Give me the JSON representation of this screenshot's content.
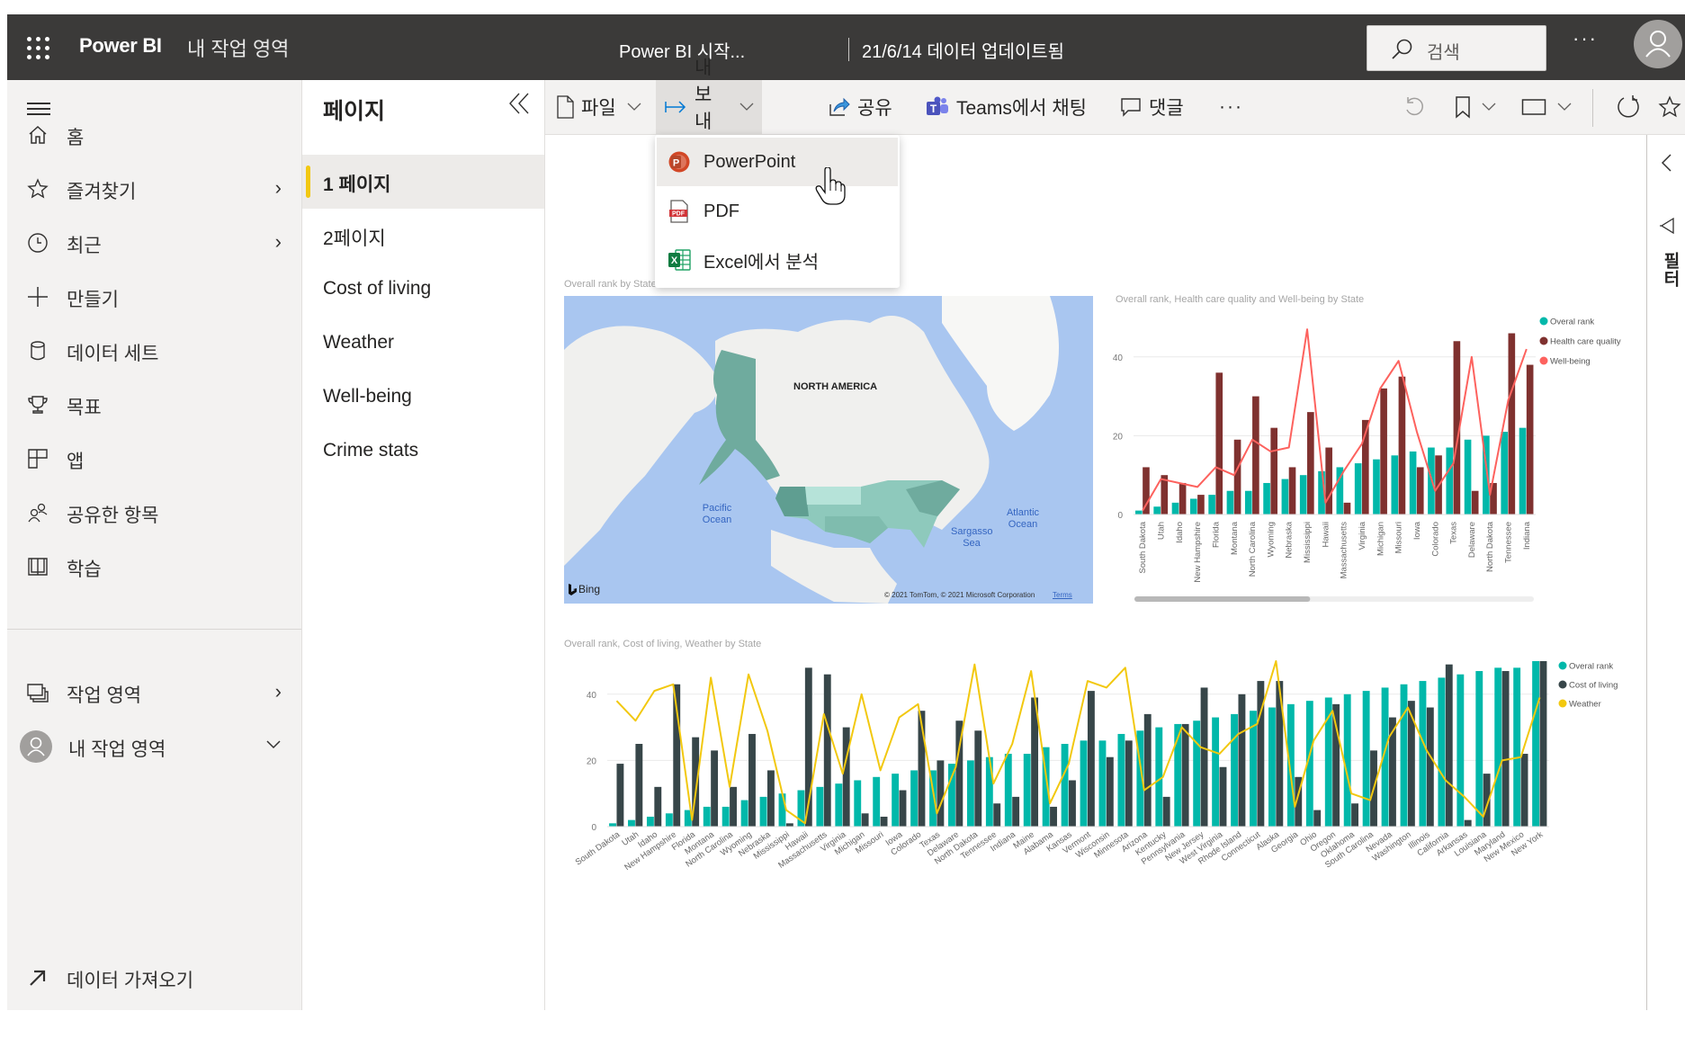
{
  "header": {
    "brand": "Power BI",
    "workspace": "내 작업 영역",
    "report_title": "Power BI 시작...",
    "updated": "21/6/14 데이터 업데이트됨",
    "search_placeholder": "검색",
    "more": "···"
  },
  "nav": {
    "items": [
      {
        "label": "홈",
        "icon": "home-icon",
        "chevron": ""
      },
      {
        "label": "즐겨찾기",
        "icon": "star-icon",
        "chevron": "›"
      },
      {
        "label": "최근",
        "icon": "clock-icon",
        "chevron": "›"
      },
      {
        "label": "만들기",
        "icon": "plus-icon",
        "chevron": ""
      },
      {
        "label": "데이터 세트",
        "icon": "database-icon",
        "chevron": ""
      },
      {
        "label": "목표",
        "icon": "trophy-icon",
        "chevron": ""
      },
      {
        "label": "앱",
        "icon": "apps-icon",
        "chevron": ""
      },
      {
        "label": "공유한 항목",
        "icon": "shared-icon",
        "chevron": ""
      },
      {
        "label": "학습",
        "icon": "book-icon",
        "chevron": ""
      }
    ],
    "workspaces": {
      "label": "작업 영역",
      "chevron": "›"
    },
    "my_workspace": {
      "label": "내 작업 영역",
      "chevron": "⌄"
    },
    "get_data": "데이터 가져오기"
  },
  "pages": {
    "title": "페이지",
    "items": [
      "1 페이지",
      "2페이지",
      "Cost of living",
      "Weather",
      "Well-being",
      "Crime stats"
    ],
    "selected_index": 0
  },
  "toolbar": {
    "file": "파일",
    "export": "내보내기",
    "share": "공유",
    "teams": "Teams에서 채팅",
    "comment": "댓글",
    "more": "···"
  },
  "export_menu": {
    "items": [
      {
        "label": "PowerPoint",
        "icon": "powerpoint-icon"
      },
      {
        "label": "PDF",
        "icon": "pdf-icon"
      },
      {
        "label": "Excel에서 분석",
        "icon": "excel-icon"
      }
    ],
    "hovered_index": 0
  },
  "filter_pane": {
    "label": "필터"
  },
  "colors": {
    "teal": "#01b8aa",
    "maroon": "#7f312f",
    "coral": "#fd625e",
    "dark_slate": "#374649",
    "yellow": "#f2c80f",
    "accent_yellow": "#f2c811"
  },
  "map": {
    "title": "Overall rank by State",
    "labels": {
      "continent": "NORTH AMERICA",
      "pacific": "Pacific Ocean",
      "atlantic": "Atlantic Ocean",
      "sargasso": "Sargasso Sea"
    },
    "bing": "Bing",
    "copyright": "© 2021 TomTom, © 2021 Microsoft Corporation",
    "terms": "Terms"
  },
  "chart_data": [
    {
      "type": "bar",
      "title": "Overall rank, Health care quality and Well-being by State",
      "xlabel": "",
      "ylabel": "",
      "ylim": [
        0,
        50
      ],
      "yticks": [
        0,
        20,
        40
      ],
      "grid": true,
      "legend": "top-right",
      "categories": [
        "South Dakota",
        "Utah",
        "Idaho",
        "New Hampshire",
        "Florida",
        "Montana",
        "North Carolina",
        "Wyoming",
        "Nebraska",
        "Mississippi",
        "Hawaii",
        "Massachusetts",
        "Virginia",
        "Michigan",
        "Missouri",
        "Iowa",
        "Colorado",
        "Texas",
        "Delaware",
        "North Dakota",
        "Tennessee",
        "Indiana"
      ],
      "series": [
        {
          "name": "Overal rank",
          "kind": "bar",
          "color": "#01b8aa",
          "values": [
            1,
            2,
            3,
            4,
            5,
            6,
            6,
            8,
            9,
            10,
            11,
            12,
            13,
            14,
            15,
            16,
            17,
            17,
            19,
            20,
            21,
            22
          ]
        },
        {
          "name": "Health care quality",
          "kind": "bar",
          "color": "#7f312f",
          "values": [
            12,
            10,
            8,
            5,
            36,
            19,
            30,
            22,
            12,
            26,
            17,
            3,
            24,
            32,
            35,
            12,
            15,
            44,
            6,
            8,
            46,
            38
          ]
        },
        {
          "name": "Well-being",
          "kind": "line",
          "color": "#fd625e",
          "values": [
            1,
            9,
            8,
            7,
            12,
            10,
            19,
            16,
            17,
            47,
            3,
            11,
            18,
            32,
            39,
            21,
            6,
            13,
            40,
            5,
            29,
            42
          ]
        }
      ],
      "scrollbar_fraction": 0.44
    },
    {
      "type": "bar",
      "title": "Overall rank, Cost of living, Weather by State",
      "xlabel": "",
      "ylabel": "",
      "ylim": [
        0,
        50
      ],
      "yticks": [
        0,
        20,
        40
      ],
      "grid": true,
      "legend": "top-right",
      "categories": [
        "South Dakota",
        "Utah",
        "Idaho",
        "New Hampshire",
        "Florida",
        "Montana",
        "North Carolina",
        "Wyoming",
        "Nebraska",
        "Mississippi",
        "Hawaii",
        "Massachusetts",
        "Virginia",
        "Michigan",
        "Missouri",
        "Iowa",
        "Colorado",
        "Texas",
        "Delaware",
        "North Dakota",
        "Tennessee",
        "Indiana",
        "Maine",
        "Alabama",
        "Kansas",
        "Vermont",
        "Wisconsin",
        "Minnesota",
        "Arizona",
        "Kentucky",
        "Pennsylvania",
        "New Jersey",
        "West Virginia",
        "Rhode Island",
        "Connecticut",
        "Alaska",
        "Georgia",
        "Ohio",
        "Oregon",
        "Oklahoma",
        "South Carolina",
        "Nevada",
        "Washington",
        "Illinois",
        "California",
        "Arkansas",
        "Louisiana",
        "Maryland",
        "New Mexico",
        "New York"
      ],
      "series": [
        {
          "name": "Overal rank",
          "kind": "bar",
          "color": "#01b8aa",
          "values": [
            1,
            2,
            3,
            4,
            5,
            6,
            6,
            8,
            9,
            10,
            11,
            12,
            13,
            14,
            15,
            16,
            17,
            17,
            19,
            20,
            21,
            22,
            22,
            24,
            25,
            26,
            26,
            28,
            29,
            30,
            31,
            32,
            33,
            34,
            35,
            36,
            37,
            38,
            39,
            40,
            41,
            42,
            43,
            44,
            45,
            46,
            47,
            48,
            48,
            50
          ]
        },
        {
          "name": "Cost of living",
          "kind": "bar",
          "color": "#374649",
          "values": [
            19,
            25,
            12,
            43,
            27,
            23,
            12,
            28,
            17,
            1,
            48,
            46,
            30,
            4,
            3,
            11,
            35,
            20,
            32,
            29,
            7,
            9,
            39,
            6,
            14,
            41,
            21,
            26,
            34,
            9,
            31,
            42,
            18,
            40,
            44,
            44,
            15,
            5,
            37,
            7,
            23,
            33,
            38,
            36,
            49,
            2,
            16,
            47,
            22,
            50
          ]
        },
        {
          "name": "Weather",
          "kind": "line",
          "color": "#f2c80f",
          "values": [
            38,
            32,
            41,
            43,
            2,
            45,
            12,
            46,
            29,
            5,
            1,
            34,
            16,
            40,
            17,
            33,
            37,
            4,
            18,
            49,
            13,
            25,
            47,
            7,
            19,
            44,
            42,
            48,
            11,
            15,
            30,
            24,
            22,
            28,
            31,
            50,
            6,
            26,
            35,
            10,
            8,
            27,
            36,
            23,
            14,
            9,
            3,
            20,
            21,
            39
          ]
        }
      ]
    }
  ]
}
